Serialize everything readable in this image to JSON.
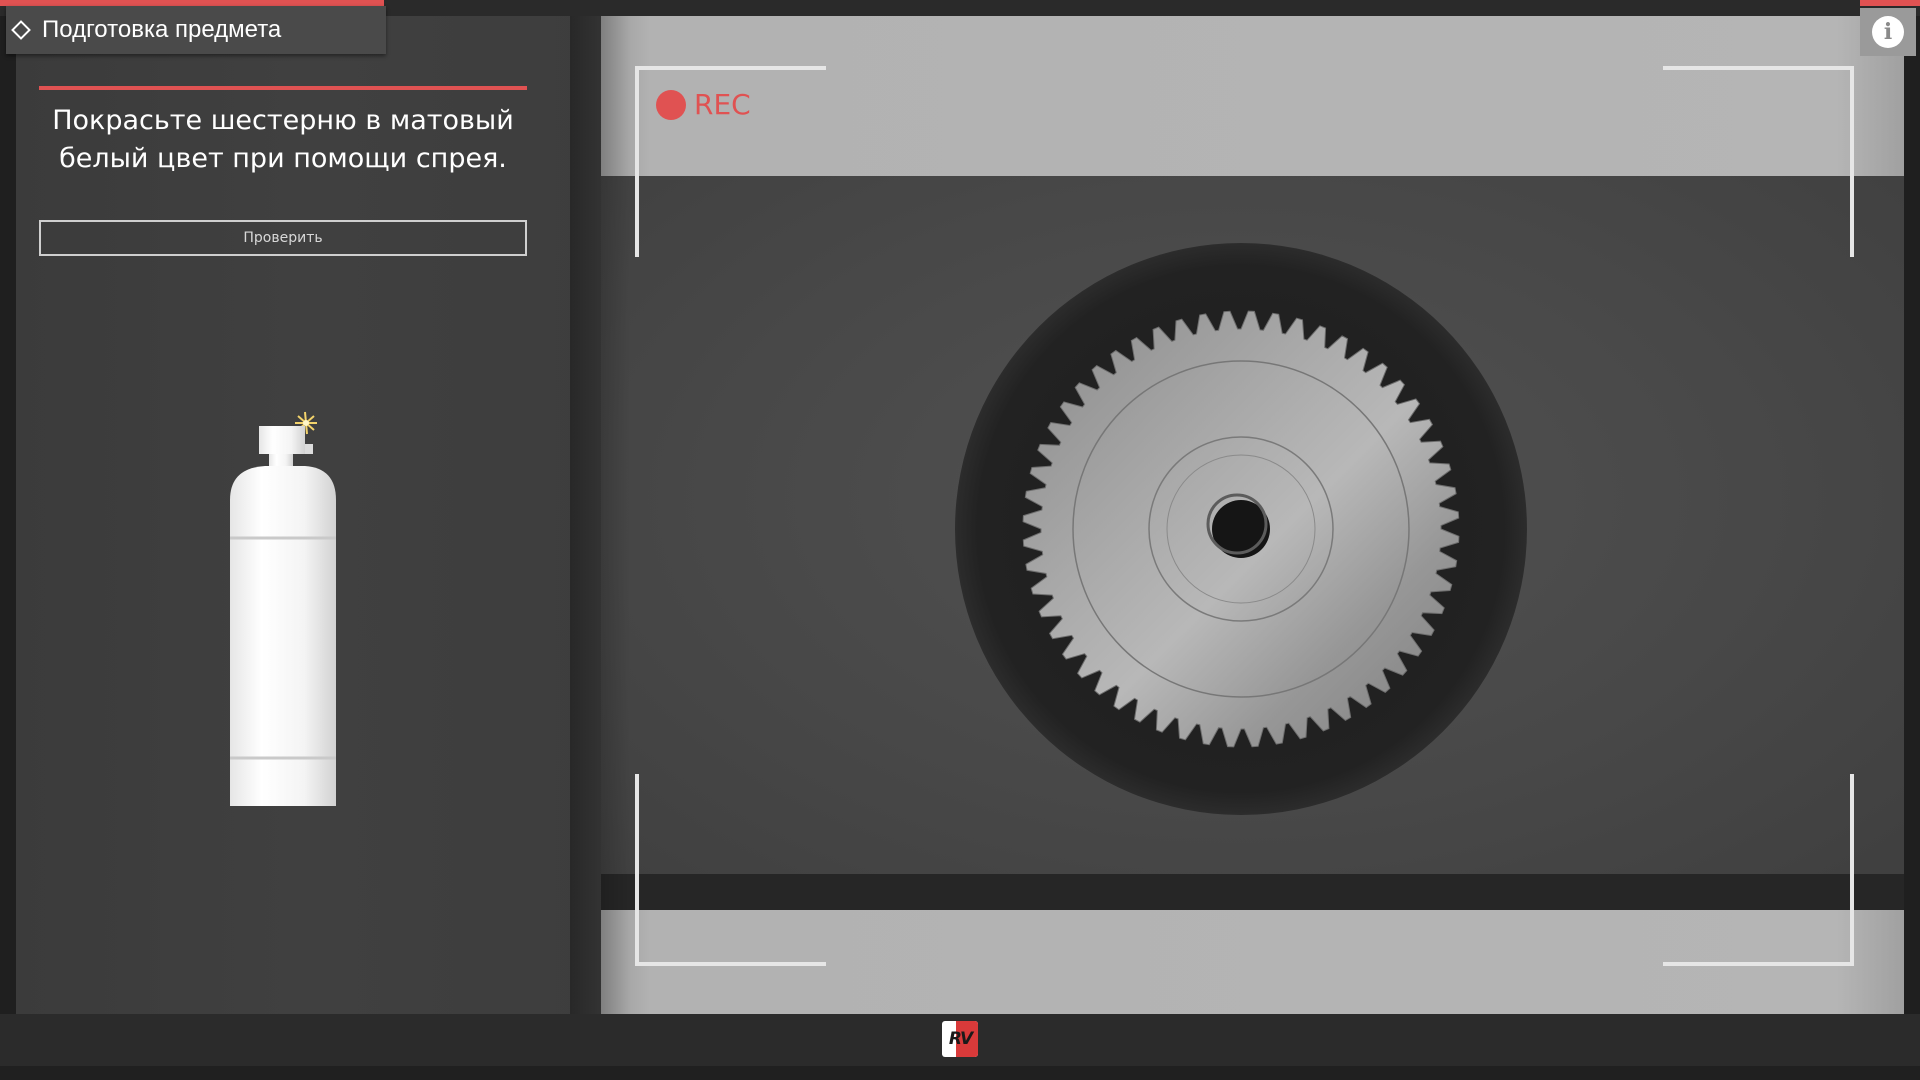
{
  "header": {
    "title": "Подготовка предмета",
    "title_icon": "diamond-outline-icon"
  },
  "task": {
    "instruction": "Покрасьте шестерню в матовый белый цвет при помощи спрея.",
    "check_button_label": "Проверить"
  },
  "tool": {
    "name": "spray-can-icon",
    "color": "#ffffff"
  },
  "viewport": {
    "rec_label": "REC",
    "object": "gear"
  },
  "info": {
    "icon_glyph": "i",
    "icon": "info-icon"
  },
  "footer": {
    "logo_text": "RV",
    "logo_icon": "brand-logo-icon"
  },
  "colors": {
    "accent": "#e05252",
    "panel": "#3e3e3e",
    "background": "#1f1f1f"
  }
}
